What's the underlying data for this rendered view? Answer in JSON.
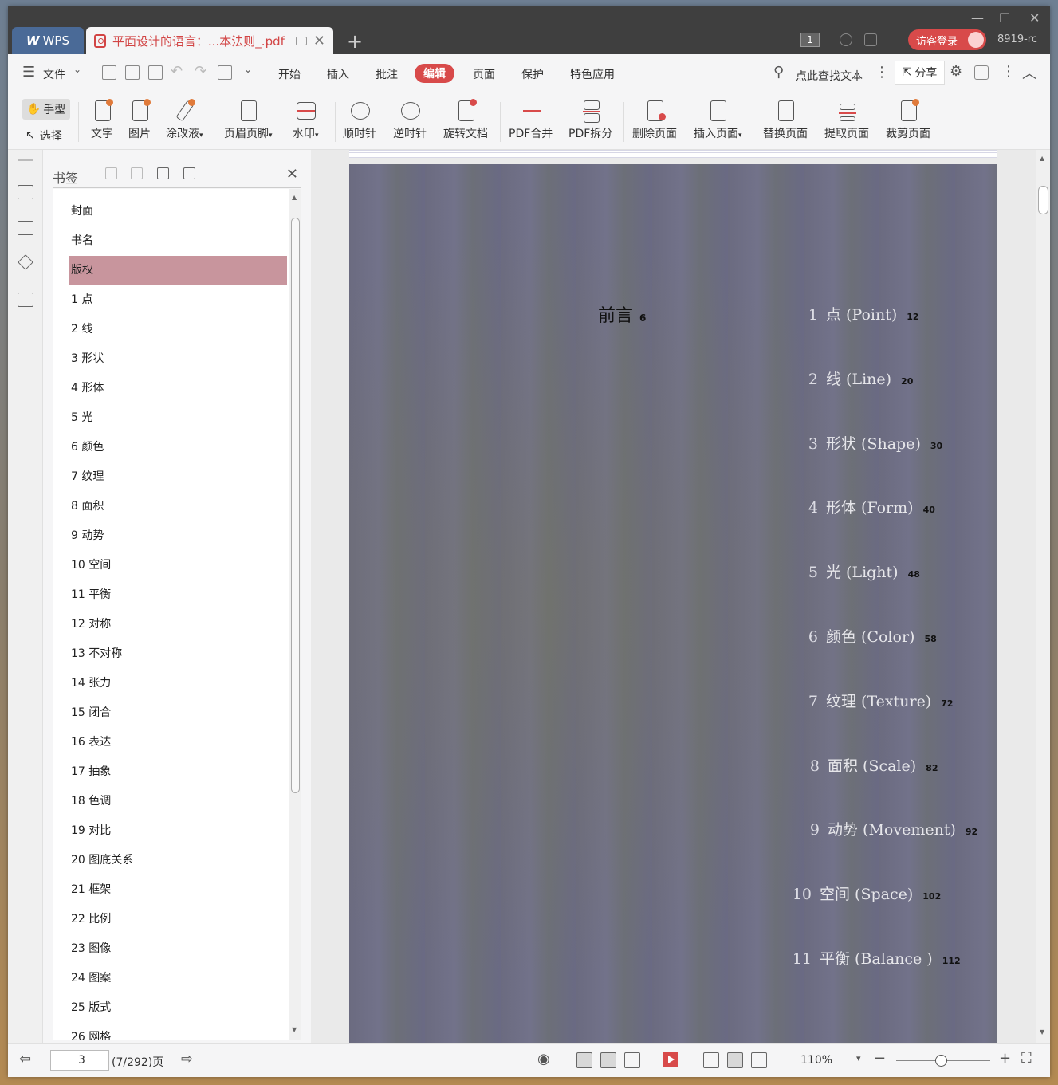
{
  "titlebar": {
    "app_tab": "WPS",
    "doc_tab_title": "平面设计的语言：...本法则_.pdf",
    "badge_count": "1",
    "login_button": "访客登录",
    "username": "8919-rc"
  },
  "menu": {
    "file": "文件",
    "items": [
      "开始",
      "插入",
      "批注",
      "编辑",
      "页面",
      "保护",
      "特色应用"
    ],
    "active": "编辑",
    "search_placeholder": "点此查找文本",
    "share": "分享"
  },
  "ribbon": {
    "hand": "手型",
    "select": "选择",
    "tools": [
      {
        "label": "文字",
        "icon": "text-edit-icon"
      },
      {
        "label": "图片",
        "icon": "image-edit-icon"
      },
      {
        "label": "涂改液",
        "icon": "correction-pen-icon",
        "dropdown": true
      },
      {
        "label": "页眉页脚",
        "icon": "header-footer-icon",
        "dropdown": true
      },
      {
        "label": "水印",
        "icon": "watermark-icon",
        "dropdown": true
      },
      {
        "label": "顺时针",
        "icon": "rotate-cw-icon"
      },
      {
        "label": "逆时针",
        "icon": "rotate-ccw-icon"
      },
      {
        "label": "旋转文档",
        "icon": "rotate-doc-icon"
      },
      {
        "label": "PDF合并",
        "icon": "pdf-merge-icon"
      },
      {
        "label": "PDF拆分",
        "icon": "pdf-split-icon"
      },
      {
        "label": "删除页面",
        "icon": "delete-page-icon"
      },
      {
        "label": "插入页面",
        "icon": "insert-page-icon",
        "dropdown": true
      },
      {
        "label": "替换页面",
        "icon": "replace-page-icon"
      },
      {
        "label": "提取页面",
        "icon": "extract-page-icon"
      },
      {
        "label": "裁剪页面",
        "icon": "crop-page-icon"
      }
    ]
  },
  "bookmarks": {
    "title": "书签",
    "selected": "版权",
    "items": [
      "封面",
      "书名",
      "版权",
      "1 点",
      "2 线",
      "3 形状",
      "4 形体",
      "5 光",
      "6 颜色",
      "7 纹理",
      "8 面积",
      "9 动势",
      "10 空间",
      "11 平衡",
      "12 对称",
      "13 不对称",
      "14 张力",
      "15 闭合",
      "16 表达",
      "17 抽象",
      "18 色调",
      "19 对比",
      "20 图底关系",
      "21 框架",
      "22 比例",
      "23 图像",
      "24 图案",
      "25 版式",
      "26 网格"
    ]
  },
  "page_content": {
    "preface": "前言",
    "preface_page": "6",
    "toc": [
      {
        "num": "1",
        "text": "点 (Point)",
        "page": "12"
      },
      {
        "num": "2",
        "text": "线 (Line)",
        "page": "20"
      },
      {
        "num": "3",
        "text": "形状 (Shape)",
        "page": "30"
      },
      {
        "num": "4",
        "text": "形体 (Form)",
        "page": "40"
      },
      {
        "num": "5",
        "text": "光 (Light)",
        "page": "48"
      },
      {
        "num": "6",
        "text": "颜色 (Color)",
        "page": "58"
      },
      {
        "num": "7",
        "text": "纹理 (Texture)",
        "page": "72"
      },
      {
        "num": "8",
        "text": "面积 (Scale)",
        "page": "82"
      },
      {
        "num": "9",
        "text": "动势 (Movement)",
        "page": "92"
      },
      {
        "num": "10",
        "text": "空间 (Space)",
        "page": "102"
      },
      {
        "num": "11",
        "text": "平衡 (Balance )",
        "page": "112"
      }
    ]
  },
  "status": {
    "page_value": "3",
    "page_total": "(7/292)页",
    "zoom": "110%"
  },
  "colors": {
    "accent": "#d84a4a",
    "selected_bookmark": "#c8959d",
    "tab_blue": "#4a6a97"
  }
}
